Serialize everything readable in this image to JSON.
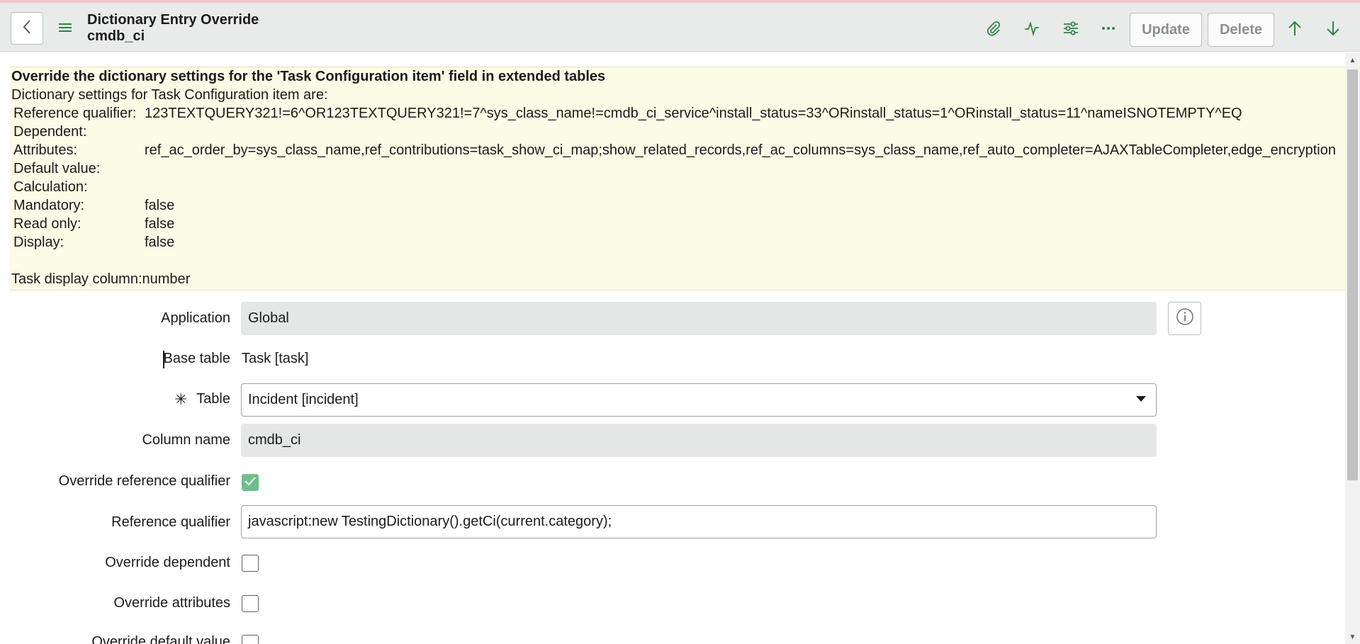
{
  "header": {
    "title": "Dictionary Entry Override",
    "subtitle": "cmdb_ci",
    "update_label": "Update",
    "delete_label": "Delete",
    "icons": [
      "back-icon",
      "hamburger-menu-icon",
      "paperclip-icon",
      "activity-icon",
      "sliders-icon",
      "more-options-icon",
      "arrow-up-icon",
      "arrow-down-icon"
    ]
  },
  "info": {
    "heading": "Override the dictionary settings for the 'Task Configuration item' field in extended tables",
    "subheading": "Dictionary settings for Task Configuration item are:",
    "rows": [
      {
        "key": "Reference qualifier:",
        "value": "123TEXTQUERY321!=6^OR123TEXTQUERY321!=7^sys_class_name!=cmdb_ci_service^install_status=33^ORinstall_status=1^ORinstall_status=11^nameISNOTEMPTY^EQ"
      },
      {
        "key": "Dependent:",
        "value": ""
      },
      {
        "key": "Attributes:",
        "value": "ref_ac_order_by=sys_class_name,ref_contributions=task_show_ci_map;show_related_records,ref_ac_columns=sys_class_name,ref_auto_completer=AJAXTableCompleter,edge_encryption"
      },
      {
        "key": "Default value:",
        "value": ""
      },
      {
        "key": "Calculation:",
        "value": ""
      },
      {
        "key": "Mandatory:",
        "value": "false"
      },
      {
        "key": "Read only:",
        "value": "false"
      },
      {
        "key": "Display:",
        "value": "false"
      }
    ],
    "footer": "Task display column:number"
  },
  "form": {
    "application": {
      "label": "Application",
      "value": "Global"
    },
    "base_table": {
      "label": "Base table",
      "value": "Task [task]"
    },
    "table": {
      "label": "Table",
      "value": "Incident [incident]",
      "required_mark": "✳"
    },
    "column_name": {
      "label": "Column name",
      "value": "cmdb_ci"
    },
    "override_reference_qualifier": {
      "label": "Override reference qualifier",
      "checked": true
    },
    "reference_qualifier": {
      "label": "Reference qualifier",
      "value": "javascript:new TestingDictionary().getCi(current.category);"
    },
    "override_dependent": {
      "label": "Override dependent",
      "checked": false
    },
    "override_attributes": {
      "label": "Override attributes",
      "checked": false
    },
    "override_default_value": {
      "label": "Override default value",
      "checked": false
    }
  },
  "colors": {
    "accent_green": "#2e8540",
    "checkbox_checked": "#6ebf8b",
    "info_background": "#fbfbe6",
    "header_background": "#e9ebea"
  }
}
